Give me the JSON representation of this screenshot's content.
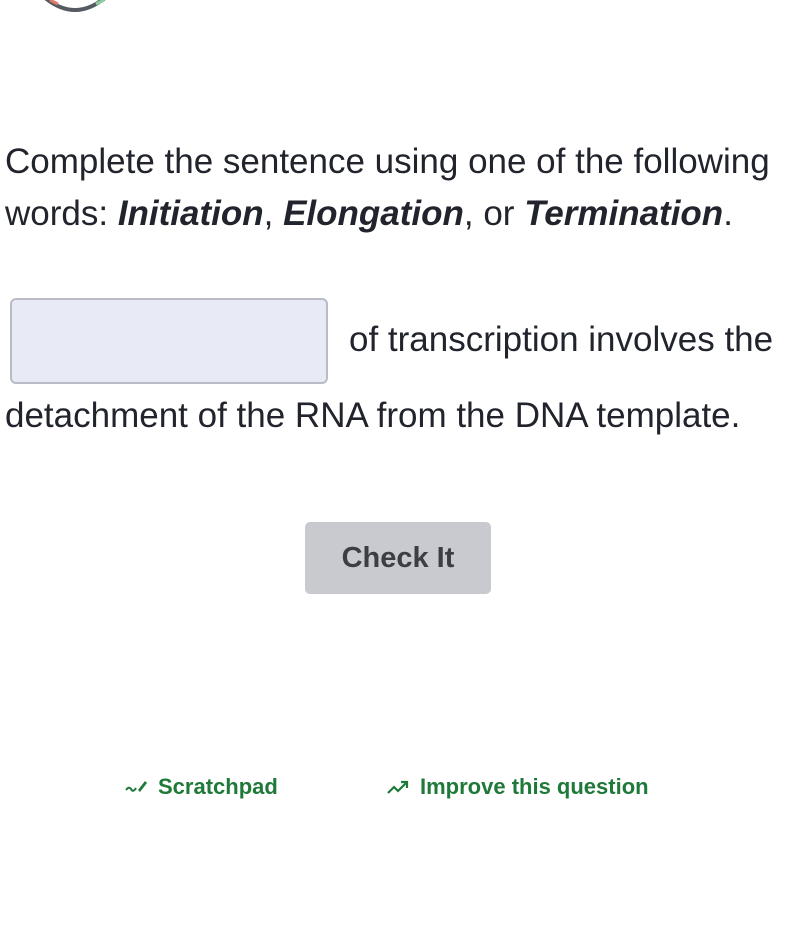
{
  "question": {
    "intro": "Complete the sentence using one of the following words: ",
    "options": [
      "Initiation",
      "Elongation",
      "Termination"
    ],
    "sep1": ", ",
    "sep2": ", or ",
    "end": ".",
    "answer_value": "",
    "sentence_after_blank": "of transcription involves the",
    "sentence_continuation": "detachment of the RNA from the DNA template."
  },
  "actions": {
    "check_label": "Check It"
  },
  "footer": {
    "scratchpad_label": "Scratchpad",
    "improve_label": "Improve this question"
  },
  "colors": {
    "link_green": "#1f7a3a",
    "button_gray": "#c8cad0",
    "blank_fill": "#e8ebf5"
  },
  "icons": {
    "scratchpad": "pencil-scribble-icon",
    "improve": "trend-up-icon"
  }
}
